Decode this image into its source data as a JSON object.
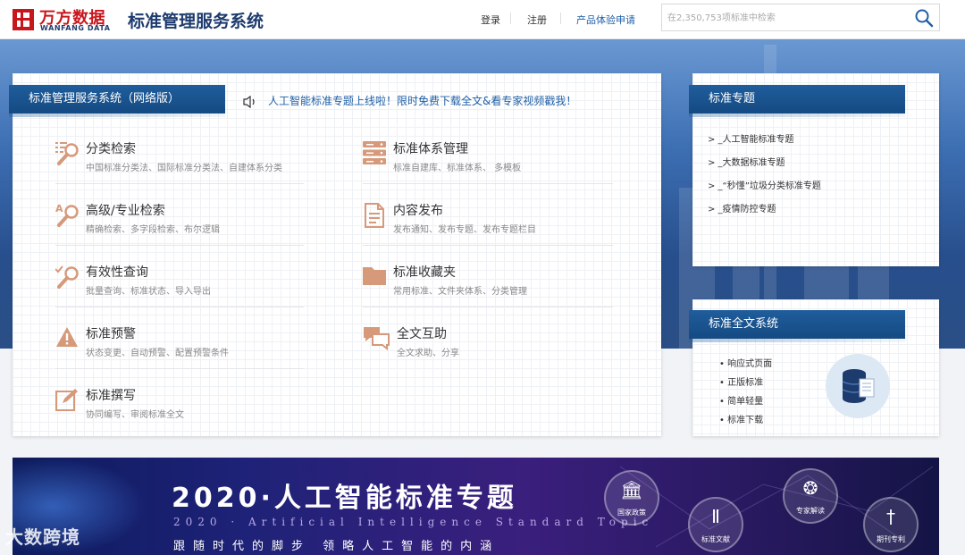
{
  "header": {
    "logo_cn": "万方数据",
    "logo_en": "WANFANG DATA",
    "site_title": "标准管理服务系统",
    "nav": {
      "login": "登录",
      "register": "注册",
      "trial_apply": "产品体验申请"
    },
    "search_placeholder": "在2,350,753项标准中检索"
  },
  "main": {
    "ribbon_title": "标准管理服务系统（网络版）",
    "notice": "人工智能标准专题上线啦！限时免费下载全文&看专家视频戳我！",
    "features": [
      {
        "title": "分类检索",
        "desc": "中国标准分类法、国际标准分类法、自建体系分类",
        "icon": "category-search-icon"
      },
      {
        "title": "标准体系管理",
        "desc": "标准自建库、标准体系、 多模板",
        "icon": "server-stack-icon"
      },
      {
        "title": "高级/专业检索",
        "desc": "精确检索、多字段检索、布尔逻辑",
        "icon": "advanced-search-icon"
      },
      {
        "title": "内容发布",
        "desc": "发布通知、发布专题、发布专题栏目",
        "icon": "document-icon"
      },
      {
        "title": "有效性查询",
        "desc": "批量查询、标准状态、导入导出",
        "icon": "check-search-icon"
      },
      {
        "title": "标准收藏夹",
        "desc": "常用标准、文件夹体系、分类管理",
        "icon": "folder-icon"
      },
      {
        "title": "标准预警",
        "desc": "状态变更、自动预警、配置预警条件",
        "icon": "warning-icon"
      },
      {
        "title": "全文互助",
        "desc": "全文求助、分享",
        "icon": "chat-bubbles-icon"
      },
      {
        "title": "标准撰写",
        "desc": "协同编写、审阅标准全文",
        "icon": "edit-icon"
      }
    ]
  },
  "topics": {
    "title": "标准专题",
    "links": [
      "> _人工智能标准专题",
      "> _大数据标准专题",
      "> _“秒懂”垃圾分类标准专题",
      "> _疫情防控专题"
    ]
  },
  "fulltext": {
    "title": "标准全文系统",
    "items": [
      "• 响应式页面",
      "• 正版标准",
      "• 简单轻量",
      "• 标准下载"
    ]
  },
  "banner": {
    "title": "2020·人工智能标准专题",
    "subtitle_en": "2020 · Artificial Intelligence Standard Topic",
    "slogan": "跟随时代的脚步 领略人工智能的内涵",
    "circles": [
      "国家政策",
      "标准文献",
      "专家解读",
      "期刊专利"
    ]
  },
  "watermark": "大数跨境",
  "colors": {
    "brand_red": "#c8161d",
    "brand_blue": "#1e3b6e",
    "ribbon_blue": "#1f5d9c",
    "link_blue": "#1f5fa6"
  }
}
